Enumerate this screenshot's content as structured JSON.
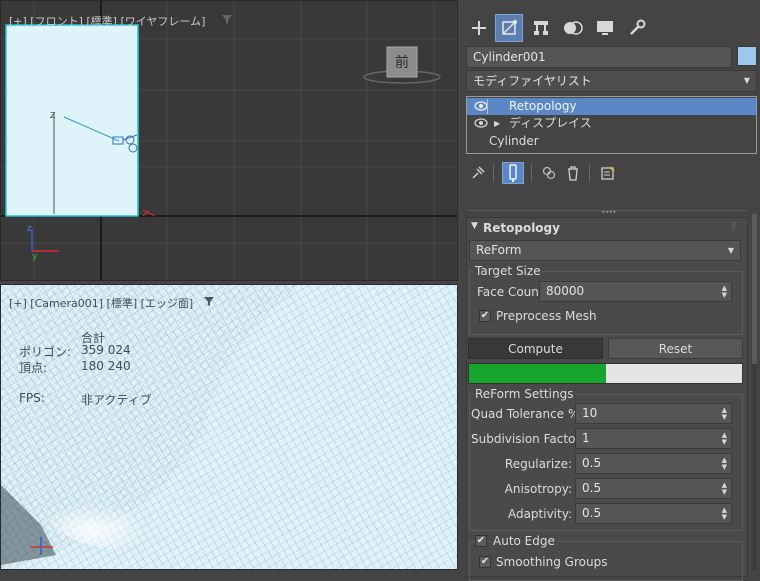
{
  "viewport_front": {
    "label": "[+] [フロント] [標準] [ワイヤフレーム]",
    "viewcube_label": "前"
  },
  "viewport_camera": {
    "label": "[+] [Camera001] [標準] [エッジ面]",
    "stats": {
      "total_label": "合計",
      "polygons_label": "ポリゴン:",
      "polygons_value": "359 024",
      "vertices_label": "頂点:",
      "vertices_value": "180 240",
      "fps_label": "FPS:",
      "fps_value": "非アクティブ"
    }
  },
  "command_panel": {
    "tabs": [
      "create-icon",
      "modify-icon",
      "hierarchy-icon",
      "motion-icon",
      "display-icon",
      "utilities-icon"
    ],
    "active_tab": "modify-icon",
    "object_name": "Cylinder001",
    "object_color": "#9fc8ee",
    "modifier_list_label": "モディファイヤリスト",
    "stack": [
      {
        "label": "Retopology",
        "selected": true
      },
      {
        "label": "ディスプレイス",
        "selected": false
      },
      {
        "label": "Cylinder",
        "selected": false
      }
    ],
    "stack_tools": [
      "pin-stack-icon",
      "show-end-result-icon",
      "make-unique-icon",
      "remove-modifier-icon",
      "configure-sets-icon"
    ]
  },
  "retopology": {
    "title": "Retopology",
    "method": "ReForm",
    "target_size_label": "Target Size",
    "face_count_label": "Face Count:",
    "face_count_value": "80000",
    "preprocess_label": "Preprocess Mesh",
    "preprocess_checked": true,
    "compute_label": "Compute",
    "reset_label": "Reset",
    "progress": 0.5,
    "progress_color": "#16a52d",
    "reform_settings_label": "ReForm Settings",
    "quad_tolerance_label": "Quad Tolerance %:",
    "quad_tolerance_value": "10",
    "subdivision_label": "Subdivision Factor:",
    "subdivision_value": "1",
    "regularize_label": "Regularize:",
    "regularize_value": "0.5",
    "anisotropy_label": "Anisotropy:",
    "anisotropy_value": "0.5",
    "adaptivity_label": "Adaptivity:",
    "adaptivity_value": "0.5",
    "auto_edge_label": "Auto Edge",
    "auto_edge_checked": true,
    "smoothing_groups_label": "Smoothing Groups",
    "smoothing_groups_checked": true
  },
  "colors": {
    "selection": "#5a87c5",
    "panel_bg": "#444444",
    "viewport_bg": "#393939"
  }
}
